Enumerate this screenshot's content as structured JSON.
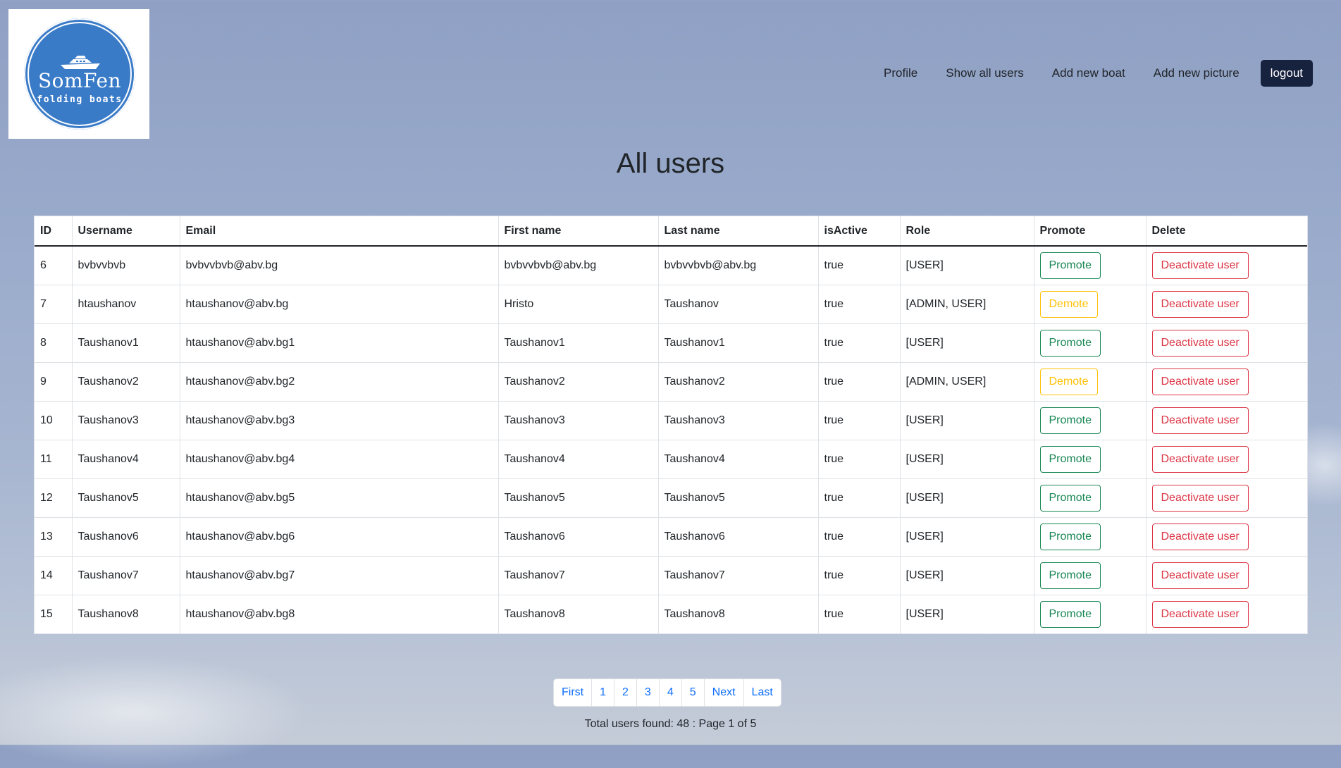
{
  "logo": {
    "name": "SomFen",
    "tagline": "folding boats"
  },
  "nav": {
    "items": [
      "Profile",
      "Show all users",
      "Add new boat",
      "Add new picture"
    ],
    "logout_label": "logout"
  },
  "page_title": "All users",
  "table": {
    "headers": [
      "ID",
      "Username",
      "Email",
      "First name",
      "Last name",
      "isActive",
      "Role",
      "Promote",
      "Delete"
    ],
    "rows": [
      {
        "id": "6",
        "username": "bvbvvbvb",
        "email": "bvbvvbvb@abv.bg",
        "first_name": "bvbvvbvb@abv.bg",
        "last_name": "bvbvvbvb@abv.bg",
        "is_active": "true",
        "role": "[USER]",
        "promote_action": "Promote",
        "delete_action": "Deactivate user"
      },
      {
        "id": "7",
        "username": "htaushanov",
        "email": "htaushanov@abv.bg",
        "first_name": "Hristo",
        "last_name": "Taushanov",
        "is_active": "true",
        "role": "[ADMIN, USER]",
        "promote_action": "Demote",
        "delete_action": "Deactivate user"
      },
      {
        "id": "8",
        "username": "Taushanov1",
        "email": "htaushanov@abv.bg1",
        "first_name": "Taushanov1",
        "last_name": "Taushanov1",
        "is_active": "true",
        "role": "[USER]",
        "promote_action": "Promote",
        "delete_action": "Deactivate user"
      },
      {
        "id": "9",
        "username": "Taushanov2",
        "email": "htaushanov@abv.bg2",
        "first_name": "Taushanov2",
        "last_name": "Taushanov2",
        "is_active": "true",
        "role": "[ADMIN, USER]",
        "promote_action": "Demote",
        "delete_action": "Deactivate user"
      },
      {
        "id": "10",
        "username": "Taushanov3",
        "email": "htaushanov@abv.bg3",
        "first_name": "Taushanov3",
        "last_name": "Taushanov3",
        "is_active": "true",
        "role": "[USER]",
        "promote_action": "Promote",
        "delete_action": "Deactivate user"
      },
      {
        "id": "11",
        "username": "Taushanov4",
        "email": "htaushanov@abv.bg4",
        "first_name": "Taushanov4",
        "last_name": "Taushanov4",
        "is_active": "true",
        "role": "[USER]",
        "promote_action": "Promote",
        "delete_action": "Deactivate user"
      },
      {
        "id": "12",
        "username": "Taushanov5",
        "email": "htaushanov@abv.bg5",
        "first_name": "Taushanov5",
        "last_name": "Taushanov5",
        "is_active": "true",
        "role": "[USER]",
        "promote_action": "Promote",
        "delete_action": "Deactivate user"
      },
      {
        "id": "13",
        "username": "Taushanov6",
        "email": "htaushanov@abv.bg6",
        "first_name": "Taushanov6",
        "last_name": "Taushanov6",
        "is_active": "true",
        "role": "[USER]",
        "promote_action": "Promote",
        "delete_action": "Deactivate user"
      },
      {
        "id": "14",
        "username": "Taushanov7",
        "email": "htaushanov@abv.bg7",
        "first_name": "Taushanov7",
        "last_name": "Taushanov7",
        "is_active": "true",
        "role": "[USER]",
        "promote_action": "Promote",
        "delete_action": "Deactivate user"
      },
      {
        "id": "15",
        "username": "Taushanov8",
        "email": "htaushanov@abv.bg8",
        "first_name": "Taushanov8",
        "last_name": "Taushanov8",
        "is_active": "true",
        "role": "[USER]",
        "promote_action": "Promote",
        "delete_action": "Deactivate user"
      }
    ]
  },
  "pagination": {
    "first": "First",
    "pages": [
      "1",
      "2",
      "3",
      "4",
      "5"
    ],
    "next": "Next",
    "last": "Last"
  },
  "footer_text": "Total users found: 48 : Page 1 of 5",
  "colors": {
    "logout_bg": "#17223f",
    "promote": "#198754",
    "demote": "#ffc107",
    "danger": "#dc3545",
    "link": "#0d6efd",
    "logo_blue": "#3a7bc8"
  }
}
